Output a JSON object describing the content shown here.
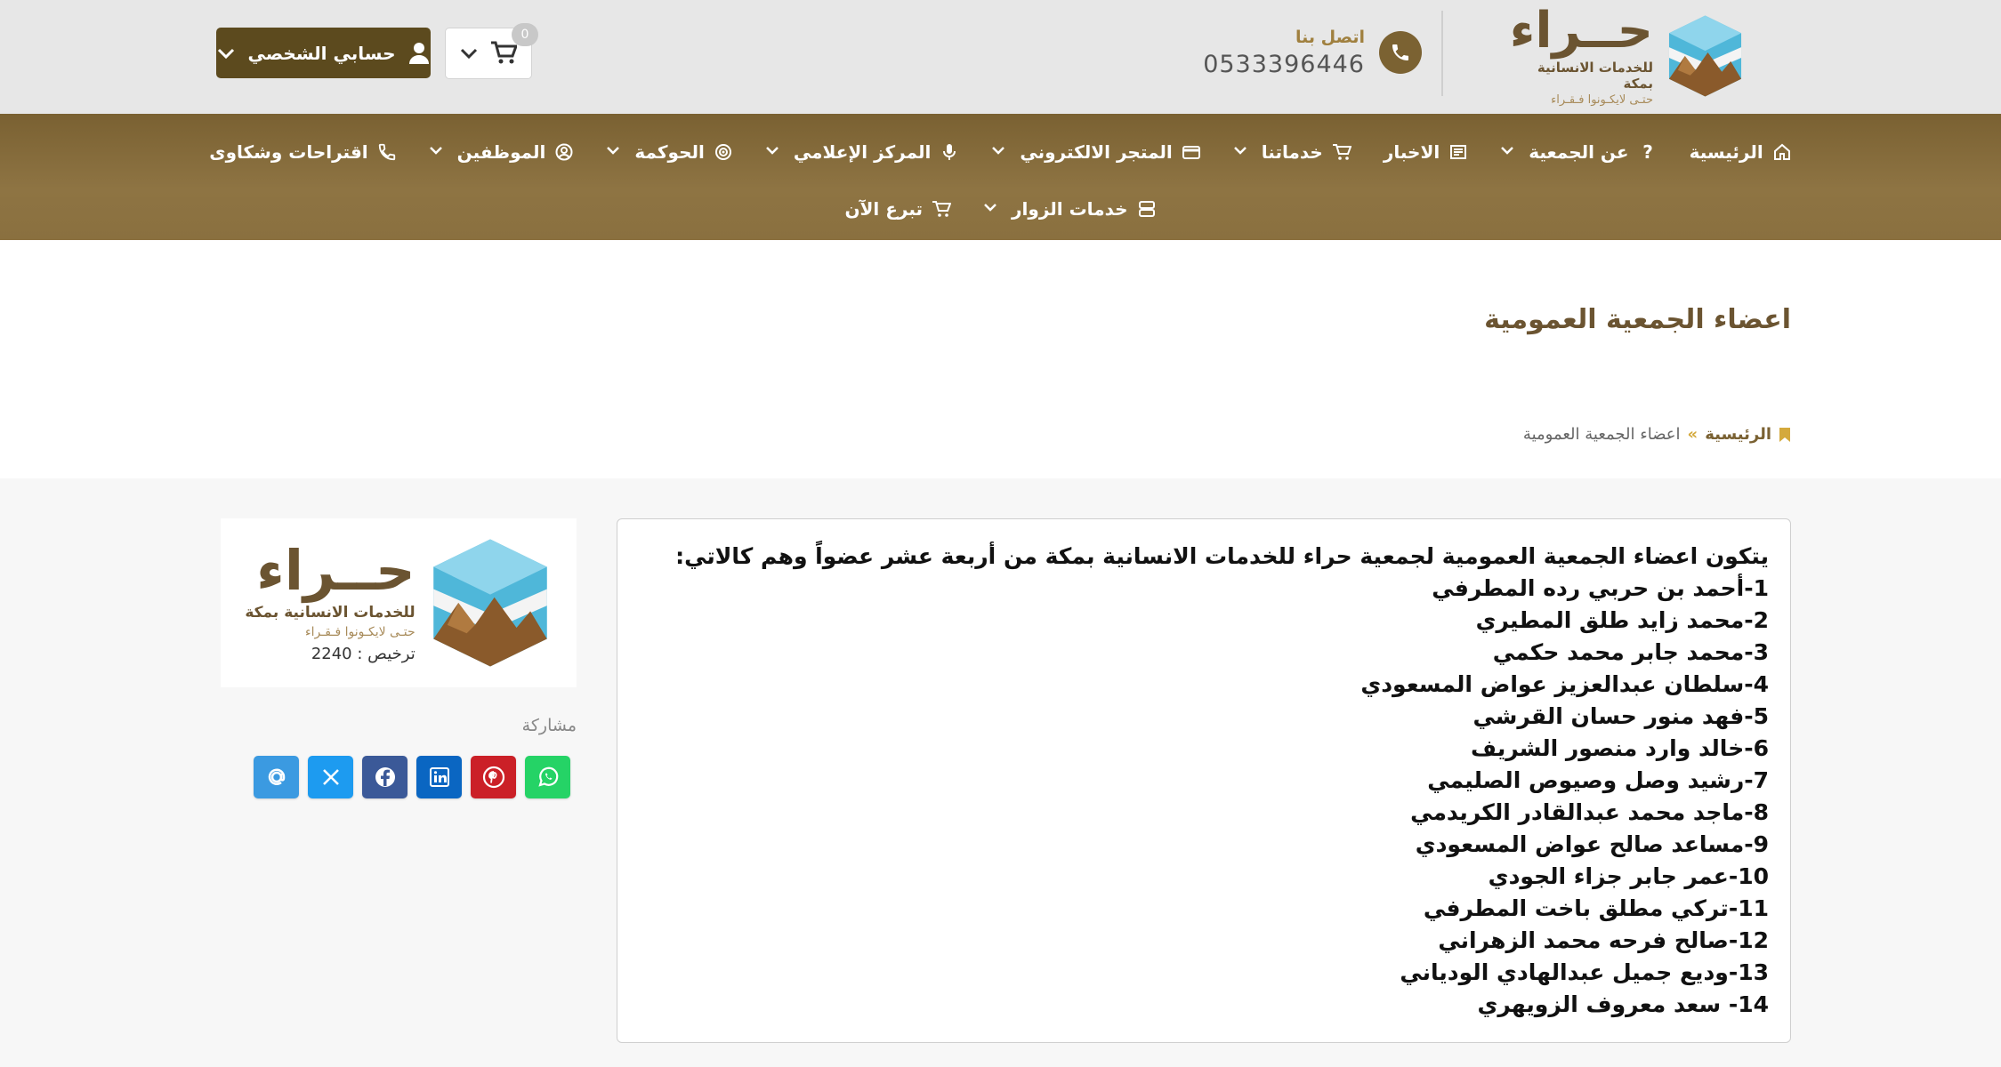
{
  "header": {
    "logo": {
      "name": "حــراء",
      "subtitle": "للخدمات الانسانية بمكة",
      "slogan": "حتـى لايكـونوا فـقـراء"
    },
    "contact": {
      "label": "اتصل بنا",
      "phone": "0533396446"
    },
    "account_label": "حسابي الشخصي",
    "cart_count": "0"
  },
  "nav": {
    "row1": [
      {
        "label": "الرئيسية",
        "icon": "home-icon",
        "dropdown": false
      },
      {
        "label": "عن الجمعية",
        "icon": "question-icon",
        "dropdown": true
      },
      {
        "label": "الاخبار",
        "icon": "newspaper-icon",
        "dropdown": false
      },
      {
        "label": "خدماتنا",
        "icon": "cart-icon",
        "dropdown": true
      },
      {
        "label": "المتجر الالكتروني",
        "icon": "card-icon",
        "dropdown": true
      },
      {
        "label": "المركز الإعلامي",
        "icon": "microphone-icon",
        "dropdown": true
      },
      {
        "label": "الحوكمة",
        "icon": "target-icon",
        "dropdown": true
      },
      {
        "label": "الموظفين",
        "icon": "user-circle-icon",
        "dropdown": true
      },
      {
        "label": "اقتراحات وشكاوى",
        "icon": "phone-icon",
        "dropdown": false
      }
    ],
    "row2": [
      {
        "label": "خدمات الزوار",
        "icon": "server-icon",
        "dropdown": true
      },
      {
        "label": "تبرع الآن",
        "icon": "cart-icon",
        "dropdown": false
      }
    ]
  },
  "page": {
    "title": "اعضاء الجمعية العمومية",
    "breadcrumb": {
      "home": "الرئيسية",
      "separator": "»",
      "current": "اعضاء الجمعية العمومية"
    }
  },
  "content": {
    "intro": "يتكون اعضاء الجمعية العمومية لجمعية حراء للخدمات الانسانية بمكة من أربعة عشر عضواً وهم كالاتي:",
    "members": [
      "1-أحمد بن حربي رده المطرفي",
      "2-محمد زايد طلق المطيري",
      "3-محمد جابر محمد حكمي",
      "4-سلطان عبدالعزيز عواض المسعودي",
      "5-فهد منور حسان القرشي",
      "6-خالد وارد منصور الشريف",
      "7-رشيد وصل وصيوص الصليمي",
      "8-ماجد محمد عبدالقادر الكريدمي",
      "9-مساعد صالح عواض المسعودي",
      "10-عمر جابر جزاء الجودي",
      "11-تركي مطلق باخت المطرفي",
      "12-صالح فرحه محمد الزهراني",
      "13-وديع جميل عبدالهادي الودياني",
      "14- سعد معروف الزويهري"
    ]
  },
  "sidebar": {
    "logo_name": "حــراء",
    "logo_subtitle": "للخدمات الانسانية بمكة",
    "logo_slogan": "حتـى لايكـونوا فـقـراء",
    "license": "ترخيص : 2240",
    "share_label": "مشاركة",
    "share_buttons": [
      {
        "name": "email",
        "color": "#3b9ae1"
      },
      {
        "name": "x",
        "color": "#1d9bf0"
      },
      {
        "name": "facebook",
        "color": "#3b5998"
      },
      {
        "name": "linkedin",
        "color": "#0a66c2"
      },
      {
        "name": "pinterest",
        "color": "#cb2027"
      },
      {
        "name": "whatsapp",
        "color": "#25d366"
      }
    ]
  },
  "colors": {
    "brand_dark": "#5c4a1e",
    "nav_bg": "#8a703f",
    "accent_gold": "#d4a93c"
  }
}
